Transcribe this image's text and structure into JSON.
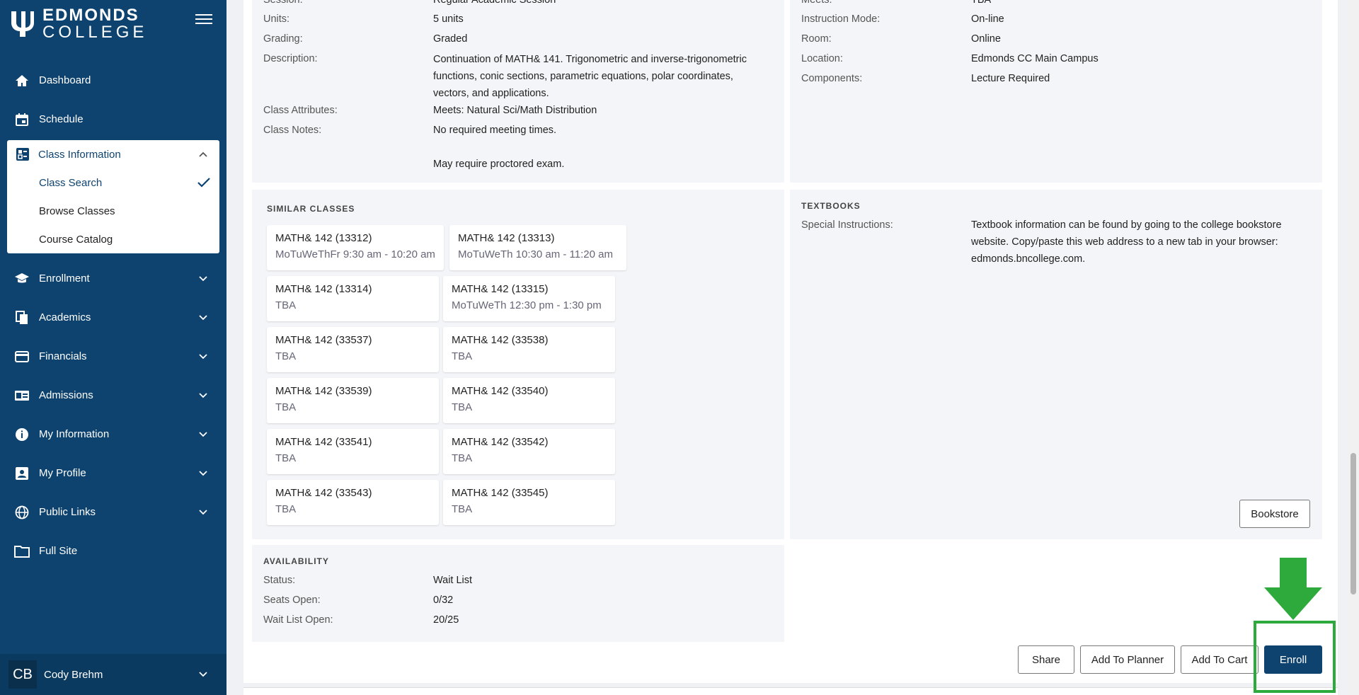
{
  "brand": {
    "line1": "EDMONDS",
    "line2": "COLLEGE"
  },
  "sidebar": {
    "items": [
      {
        "label": "Dashboard",
        "icon": "home-icon"
      },
      {
        "label": "Schedule",
        "icon": "calendar-icon"
      }
    ],
    "class_information": {
      "label": "Class Information",
      "subitems": [
        "Class Search",
        "Browse Classes",
        "Course Catalog"
      ]
    },
    "more_items": [
      {
        "label": "Enrollment",
        "icon": "graduation-cap-icon"
      },
      {
        "label": "Academics",
        "icon": "documents-icon"
      },
      {
        "label": "Financials",
        "icon": "credit-card-icon"
      },
      {
        "label": "Admissions",
        "icon": "id-card-icon"
      },
      {
        "label": "My Information",
        "icon": "info-icon"
      },
      {
        "label": "My Profile",
        "icon": "profile-icon"
      },
      {
        "label": "Public Links",
        "icon": "globe-icon"
      },
      {
        "label": "Full Site",
        "icon": "folder-icon"
      }
    ],
    "user": {
      "initials": "CB",
      "name": "Cody Brehm"
    }
  },
  "details_left": {
    "session_label": "Session:",
    "session_value": "Regular Academic Session",
    "units_label": "Units:",
    "units_value": "5 units",
    "grading_label": "Grading:",
    "grading_value": "Graded",
    "description_label": "Description:",
    "description_lines": [
      "Continuation of MATH& 141. Trigonometric and inverse-trigonometric",
      "functions, conic sections, parametric equations, polar coordinates,",
      "vectors, and applications."
    ],
    "attributes_label": "Class Attributes:",
    "attributes_value": "Meets: Natural Sci/Math Distribution",
    "notes_label": "Class Notes:",
    "notes_line1": "No required meeting times.",
    "notes_line2": "May require proctored exam."
  },
  "details_right": {
    "meets_label": "Meets:",
    "meets_value": "TBA",
    "mode_label": "Instruction Mode:",
    "mode_value": "On-line",
    "room_label": "Room:",
    "room_value": "Online",
    "location_label": "Location:",
    "location_value": "Edmonds CC Main Campus",
    "components_label": "Components:",
    "components_value": "Lecture Required"
  },
  "similar": {
    "title": "SIMILAR CLASSES",
    "cards": [
      {
        "title": "MATH& 142 (13312)",
        "sub": "MoTuWeThFr 9:30 am - 10:20 am"
      },
      {
        "title": "MATH& 142 (13313)",
        "sub": "MoTuWeTh 10:30 am - 11:20 am"
      },
      {
        "title": "MATH& 142 (13314)",
        "sub": "TBA"
      },
      {
        "title": "MATH& 142 (13315)",
        "sub": "MoTuWeTh 12:30 pm - 1:30 pm"
      },
      {
        "title": "MATH& 142 (33537)",
        "sub": "TBA"
      },
      {
        "title": "MATH& 142 (33538)",
        "sub": "TBA"
      },
      {
        "title": "MATH& 142 (33539)",
        "sub": "TBA"
      },
      {
        "title": "MATH& 142 (33540)",
        "sub": "TBA"
      },
      {
        "title": "MATH& 142 (33541)",
        "sub": "TBA"
      },
      {
        "title": "MATH& 142 (33542)",
        "sub": "TBA"
      },
      {
        "title": "MATH& 142 (33543)",
        "sub": "TBA"
      },
      {
        "title": "MATH& 142 (33545)",
        "sub": "TBA"
      }
    ]
  },
  "textbooks": {
    "title": "TEXTBOOKS",
    "label": "Special Instructions:",
    "lines": [
      "Textbook information can be found by going to the college bookstore",
      "website. Copy/paste this web address to a new tab in your browser:",
      "edmonds.bncollege.com."
    ],
    "button": "Bookstore"
  },
  "availability": {
    "title": "AVAILABILITY",
    "status_label": "Status:",
    "status_value": "Wait List",
    "seats_label": "Seats Open:",
    "seats_value": "0/32",
    "wait_label": "Wait List Open:",
    "wait_value": "20/25"
  },
  "actions": {
    "share": "Share",
    "planner": "Add To Planner",
    "cart": "Add To Cart",
    "enroll": "Enroll"
  },
  "colors": {
    "sidebar": "#0e4370",
    "highlight": "#2eaa3c"
  }
}
